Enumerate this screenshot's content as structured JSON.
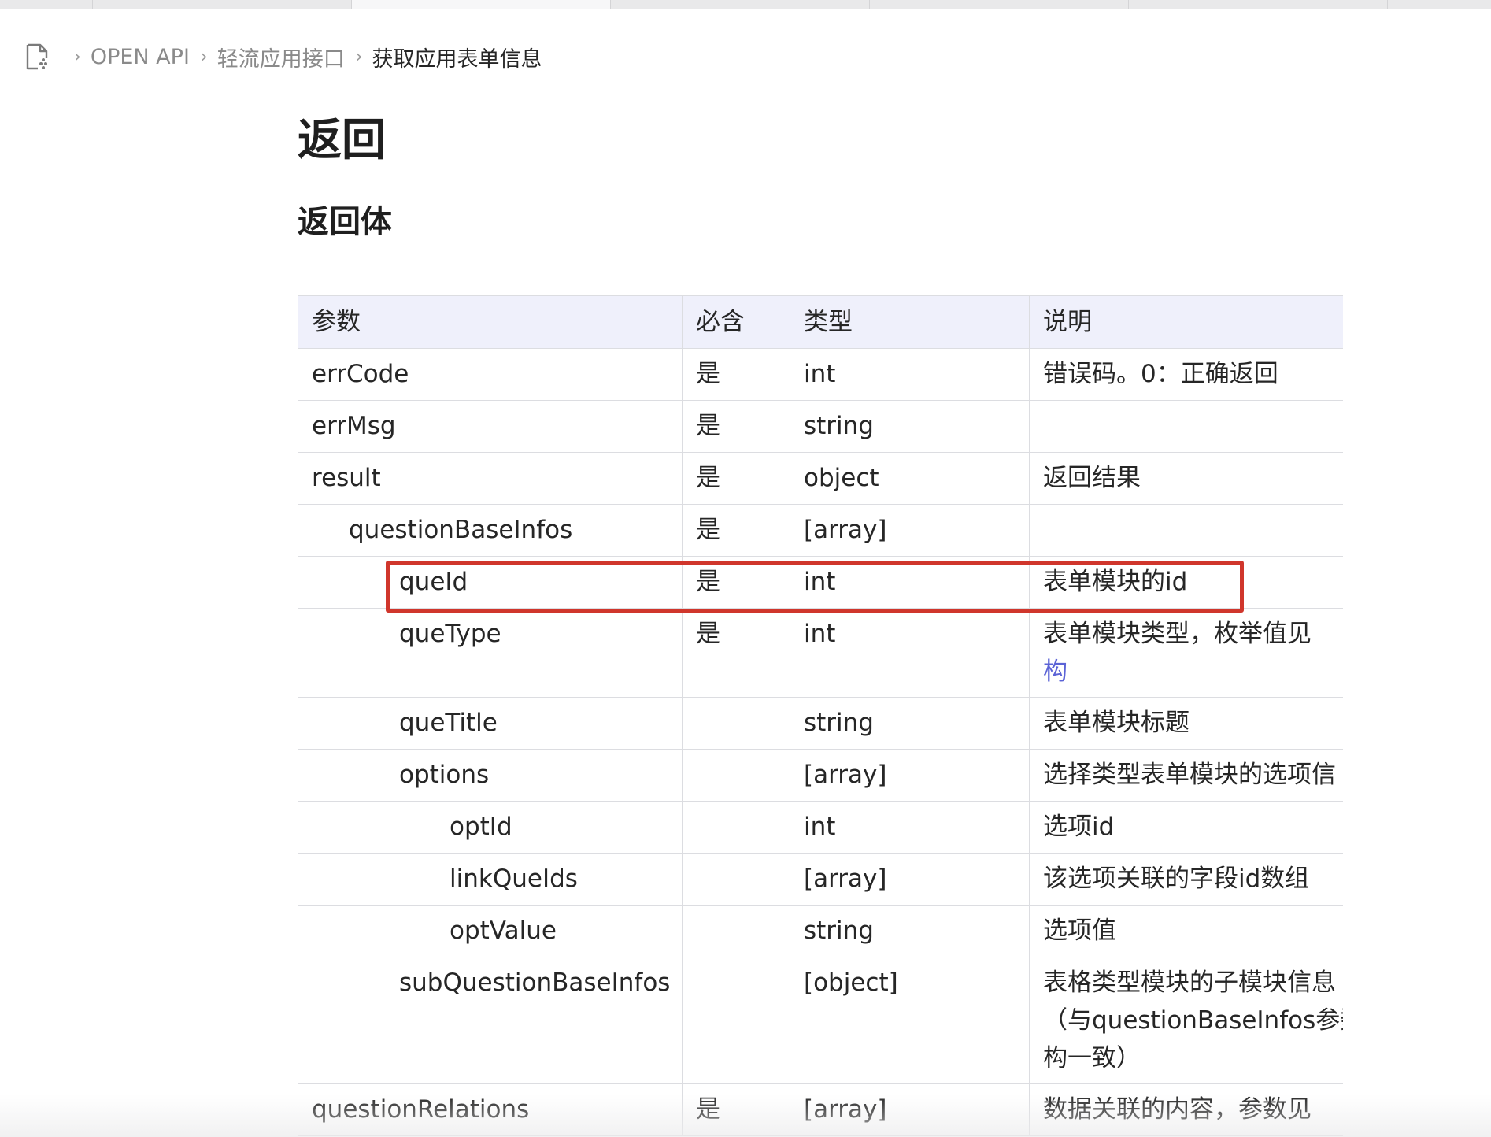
{
  "breadcrumb": {
    "items": [
      "OPEN API",
      "轻流应用接口",
      "获取应用表单信息"
    ]
  },
  "headings": {
    "h1": "返回",
    "h2": "返回体"
  },
  "table": {
    "headers": [
      "参数",
      "必含",
      "类型",
      "说明"
    ],
    "rows": [
      {
        "param": "errCode",
        "required": "是",
        "type": "int",
        "desc": "错误码。0：正确返回"
      },
      {
        "param": "errMsg",
        "required": "是",
        "type": "string",
        "desc": ""
      },
      {
        "param": "result",
        "required": "是",
        "type": "object",
        "desc": "返回结果"
      },
      {
        "param": "questionBaseInfos",
        "required": "是",
        "type": "[array]",
        "desc": ""
      },
      {
        "param": "queId",
        "required": "是",
        "type": "int",
        "desc": "表单模块的id"
      },
      {
        "param": "queType",
        "required": "是",
        "type": "int",
        "desc": "表单模块类型，枚举值见",
        "desc_link": "构"
      },
      {
        "param": "queTitle",
        "required": "",
        "type": "string",
        "desc": "表单模块标题"
      },
      {
        "param": "options",
        "required": "",
        "type": "[array]",
        "desc": "选择类型表单模块的选项信"
      },
      {
        "param": "optId",
        "required": "",
        "type": "int",
        "desc": "选项id"
      },
      {
        "param": "linkQueIds",
        "required": "",
        "type": "[array]",
        "desc": "该选项关联的字段id数组"
      },
      {
        "param": "optValue",
        "required": "",
        "type": "string",
        "desc": "选项值"
      },
      {
        "param": "subQuestionBaseInfos",
        "required": "",
        "type": "[object]",
        "desc": "表格类型模块的子模块信息",
        "desc_2": "（与questionBaseInfos参数",
        "desc_3": "构一致）"
      },
      {
        "param": "questionRelations",
        "required": "是",
        "type": "[array]",
        "desc": "数据关联的内容，参数见"
      }
    ]
  },
  "colors": {
    "header_bg": "#eff0fb",
    "border": "#dcdde1",
    "highlight": "#d0362c",
    "link": "#5b63d6"
  },
  "icons": {
    "breadcrumb_root": "document-icon",
    "separator": "chevron-right-icon"
  }
}
